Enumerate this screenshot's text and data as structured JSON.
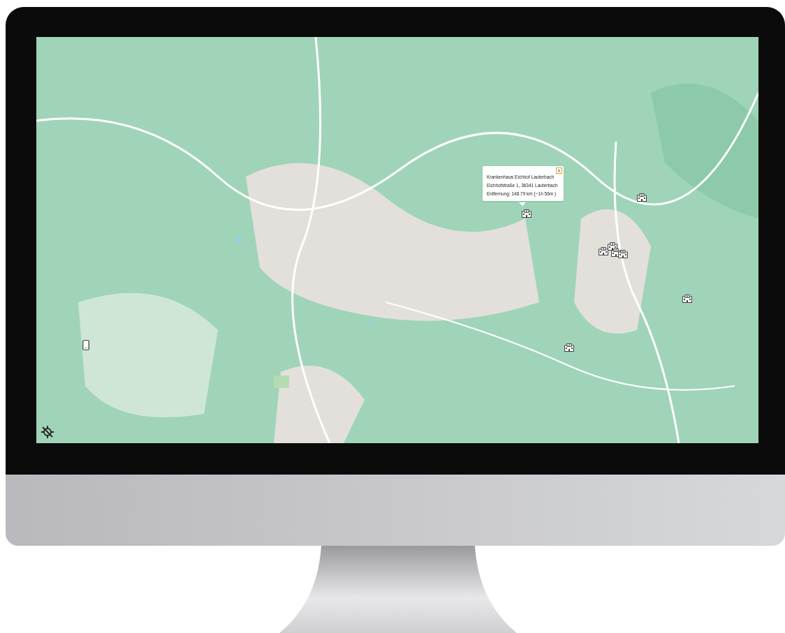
{
  "map": {
    "kind": "picture",
    "popup": {
      "close": "×",
      "lines": [
        "Krankenhaus Eichhof Lauterbach",
        "Eichhofstraße 1, 36341 Lauterbach",
        "Entfernung: 148.79 km (~1h 56m )"
      ]
    },
    "markers": [
      {
        "kind": "hospital"
      },
      {
        "kind": "hospital"
      },
      {
        "kind": "hospital"
      },
      {
        "kind": "hospital"
      },
      {
        "kind": "hospital"
      },
      {
        "kind": "hospital"
      },
      {
        "kind": "hospital"
      },
      {
        "kind": "hospital"
      },
      {
        "kind": "phone"
      }
    ],
    "controls": [
      {
        "kind": "location-off"
      }
    ]
  }
}
